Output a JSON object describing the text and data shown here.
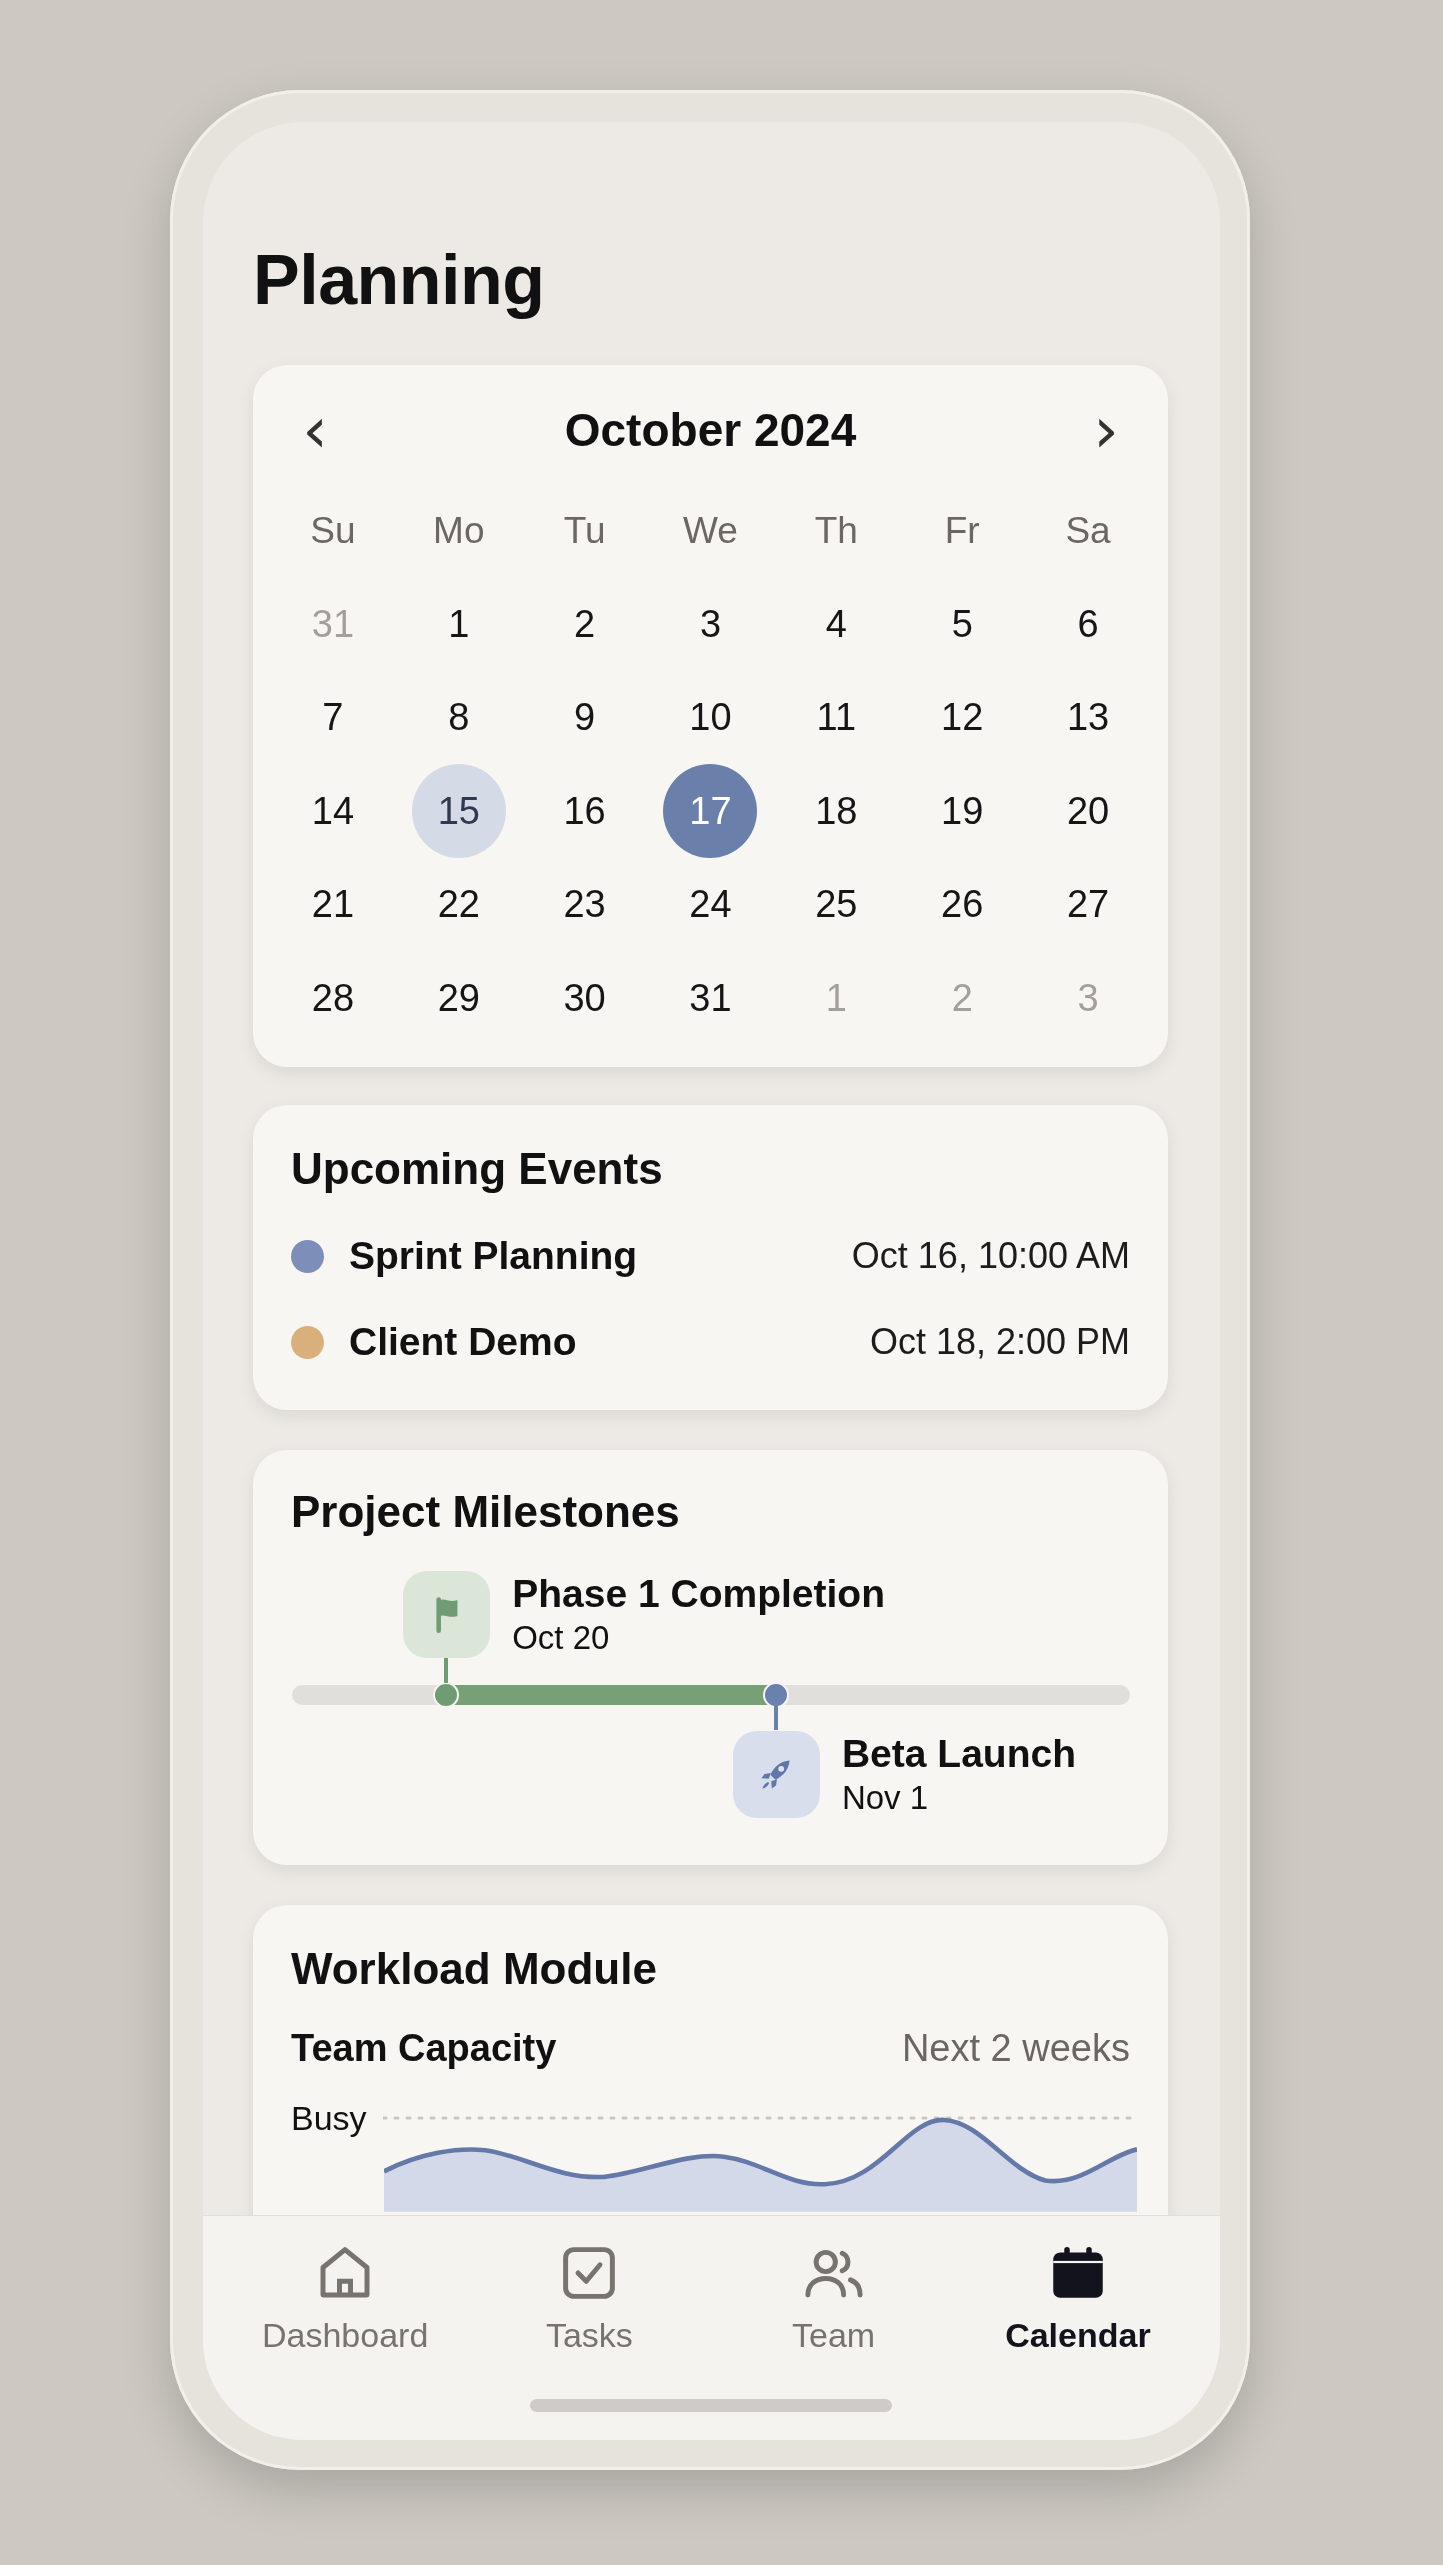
{
  "title": "Planning",
  "calendar": {
    "month": "October 2024",
    "prev": "‹",
    "next": "›",
    "weekdays": [
      "Su",
      "Mo",
      "Tu",
      "We",
      "Th",
      "Fr",
      "Sa"
    ],
    "days": [
      {
        "label": "31",
        "muted": true,
        "selected": false,
        "highlighted": false
      },
      {
        "label": "1",
        "muted": false,
        "selected": false,
        "highlighted": false
      },
      {
        "label": "2",
        "muted": false,
        "selected": false,
        "highlighted": false
      },
      {
        "label": "3",
        "muted": false,
        "selected": false,
        "highlighted": false
      },
      {
        "label": "4",
        "muted": false,
        "selected": false,
        "highlighted": false
      },
      {
        "label": "5",
        "muted": false,
        "selected": false,
        "highlighted": false
      },
      {
        "label": "6",
        "muted": false,
        "selected": false,
        "highlighted": false
      },
      {
        "label": "7",
        "muted": false,
        "selected": false,
        "highlighted": false
      },
      {
        "label": "8",
        "muted": false,
        "selected": false,
        "highlighted": false
      },
      {
        "label": "9",
        "muted": false,
        "selected": false,
        "highlighted": false
      },
      {
        "label": "10",
        "muted": false,
        "selected": false,
        "highlighted": false
      },
      {
        "label": "11",
        "muted": false,
        "selected": false,
        "highlighted": false
      },
      {
        "label": "12",
        "muted": false,
        "selected": false,
        "highlighted": false
      },
      {
        "label": "13",
        "muted": false,
        "selected": false,
        "highlighted": false
      },
      {
        "label": "14",
        "muted": false,
        "selected": false,
        "highlighted": false
      },
      {
        "label": "15",
        "muted": false,
        "selected": false,
        "highlighted": true
      },
      {
        "label": "16",
        "muted": false,
        "selected": false,
        "highlighted": false
      },
      {
        "label": "17",
        "muted": false,
        "selected": true,
        "highlighted": false
      },
      {
        "label": "18",
        "muted": false,
        "selected": false,
        "highlighted": false
      },
      {
        "label": "19",
        "muted": false,
        "selected": false,
        "highlighted": false
      },
      {
        "label": "20",
        "muted": false,
        "selected": false,
        "highlighted": false
      },
      {
        "label": "21",
        "muted": false,
        "selected": false,
        "highlighted": false
      },
      {
        "label": "22",
        "muted": false,
        "selected": false,
        "highlighted": false
      },
      {
        "label": "23",
        "muted": false,
        "selected": false,
        "highlighted": false
      },
      {
        "label": "24",
        "muted": false,
        "selected": false,
        "highlighted": false
      },
      {
        "label": "25",
        "muted": false,
        "selected": false,
        "highlighted": false
      },
      {
        "label": "26",
        "muted": false,
        "selected": false,
        "highlighted": false
      },
      {
        "label": "27",
        "muted": false,
        "selected": false,
        "highlighted": false
      },
      {
        "label": "28",
        "muted": false,
        "selected": false,
        "highlighted": false
      },
      {
        "label": "29",
        "muted": false,
        "selected": false,
        "highlighted": false
      },
      {
        "label": "30",
        "muted": false,
        "selected": false,
        "highlighted": false
      },
      {
        "label": "31",
        "muted": false,
        "selected": false,
        "highlighted": false
      },
      {
        "label": "1",
        "muted": true,
        "selected": false,
        "highlighted": false
      },
      {
        "label": "2",
        "muted": true,
        "selected": false,
        "highlighted": false
      },
      {
        "label": "3",
        "muted": true,
        "selected": false,
        "highlighted": false
      }
    ]
  },
  "events": {
    "title": "Upcoming Events",
    "items": [
      {
        "name": "Sprint Planning",
        "time": "Oct 16, 10:00 AM",
        "color": "#7d8fb8"
      },
      {
        "name": "Client Demo",
        "time": "Oct 18, 2:00 PM",
        "color": "#d9b07c"
      }
    ]
  },
  "milestones": {
    "title": "Project Milestones",
    "items": [
      {
        "kind": "flag",
        "name": "Phase 1 Completion",
        "date": "Oct 20",
        "level": 0.185
      },
      {
        "kind": "rocket",
        "name": "Beta Launch",
        "date": "Nov 1",
        "level": 0.578
      }
    ]
  },
  "workload": {
    "title": "Workload Module",
    "subtitle": "Team Capacity",
    "range": "Next 2 weeks",
    "axis_label": "Busy"
  },
  "nav": [
    {
      "kind": "home",
      "label": "Dashboard",
      "selected": false
    },
    {
      "kind": "tasks",
      "label": "Tasks",
      "selected": false
    },
    {
      "kind": "team",
      "label": "Team",
      "selected": false
    },
    {
      "kind": "calendar",
      "label": "Calendar",
      "selected": true
    }
  ]
}
